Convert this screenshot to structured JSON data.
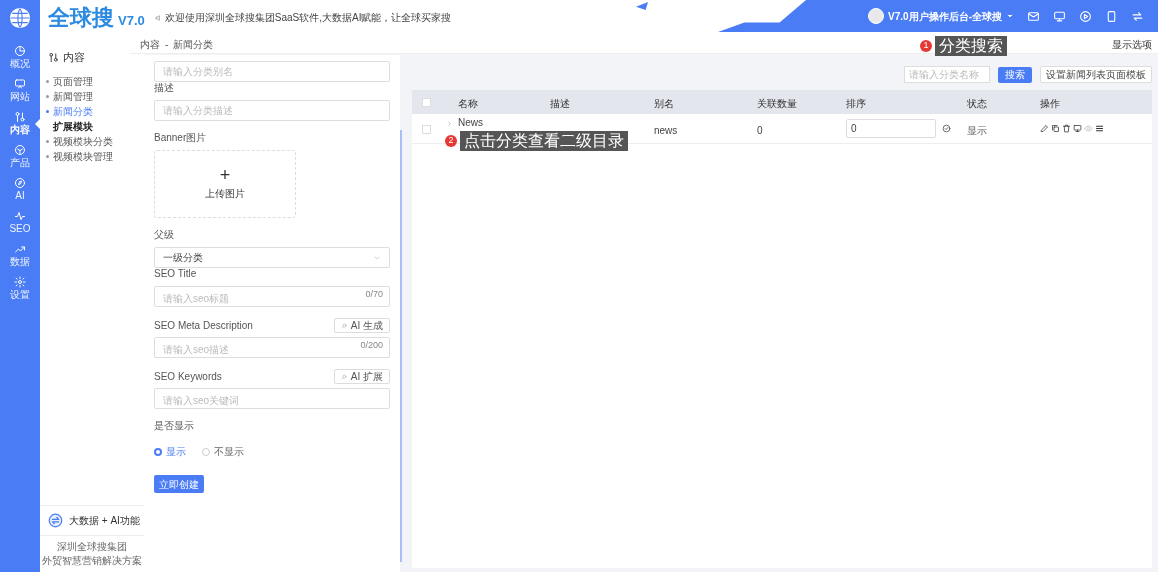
{
  "brand": {
    "name": "全球搜",
    "version": "V7.0"
  },
  "welcome": "欢迎使用深圳全球搜集团SaaS软件,大数据AI赋能，让全球买家搜",
  "account": {
    "name": "V7.0用户操作后台-全球搜"
  },
  "rail": [
    {
      "label": "概况",
      "selected": false
    },
    {
      "label": "网站",
      "selected": false
    },
    {
      "label": "内容",
      "selected": true
    },
    {
      "label": "产品",
      "selected": false
    },
    {
      "label": "AI",
      "selected": false
    },
    {
      "label": "SEO",
      "selected": false
    },
    {
      "label": "数据",
      "selected": false
    },
    {
      "label": "设置",
      "selected": false
    }
  ],
  "submenu": {
    "title": "内容",
    "items": [
      {
        "label": "页面管理",
        "kind": "link",
        "selected": false
      },
      {
        "label": "新闻管理",
        "kind": "link",
        "selected": false
      },
      {
        "label": "新闻分类",
        "kind": "link",
        "selected": true
      },
      {
        "label": "扩展模块",
        "kind": "heading",
        "selected": false
      },
      {
        "label": "视频模块分类",
        "kind": "link",
        "selected": false
      },
      {
        "label": "视频模块管理",
        "kind": "link",
        "selected": false
      }
    ],
    "feature": "大数据 + AI功能",
    "footer": [
      "深圳全球搜集团",
      "外贸智慧营销解决方案"
    ]
  },
  "breadcrumb": {
    "items": [
      "内容",
      "新闻分类"
    ],
    "separator": "-"
  },
  "display_options": "显示选项",
  "form": {
    "name_placeholder": "请输入分类别名",
    "desc_label": "描述",
    "desc_placeholder": "请输入分类描述",
    "banner_label": "Banner图片",
    "upload_icon": "+",
    "upload_label": "上传图片",
    "parent_label": "父级",
    "parent_value": "一级分类",
    "seo_title_label": "SEO Title",
    "seo_title_placeholder": "请输入seo标题",
    "seo_title_count": "0/70",
    "meta_label": "SEO Meta Description",
    "meta_button": "AI 生成",
    "meta_placeholder": "请输入seo描述",
    "meta_count": "0/200",
    "keywords_label": "SEO Keywords",
    "keywords_button": "AI 扩展",
    "keywords_placeholder": "请输入seo关键词",
    "visible_label": "是否显示",
    "visible_options": [
      {
        "label": "显示",
        "selected": true
      },
      {
        "label": "不显示",
        "selected": false
      }
    ],
    "submit": "立即创建"
  },
  "search": {
    "placeholder": "请输入分类名称",
    "button": "搜索",
    "template_button": "设置新闻列表页面模板"
  },
  "table": {
    "all_checked": false,
    "columns": [
      "名称",
      "描述",
      "别名",
      "关联数量",
      "排序",
      "状态",
      "操作"
    ],
    "rows": [
      {
        "name": "News",
        "alias": "news",
        "count": "0",
        "sort": "0",
        "status": "显示",
        "checked": false,
        "expanded": false
      }
    ]
  },
  "annotations": [
    {
      "number": "1",
      "text": "分类搜索"
    },
    {
      "number": "2",
      "text": "点击分类查看二级目录"
    }
  ]
}
